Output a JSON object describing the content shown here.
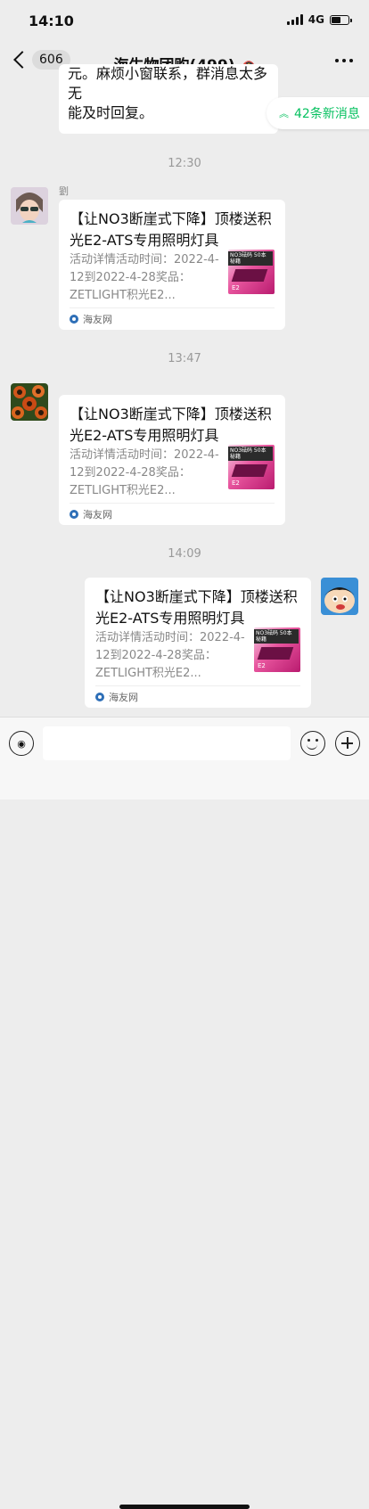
{
  "status": {
    "time": "14:10",
    "network": "4G",
    "battery_level": 0.6
  },
  "header": {
    "back_count": "606",
    "title": "海生物团购(499)",
    "mute_icon": "bell-slash-icon",
    "more_icon": "more-dots-icon"
  },
  "partial_message": {
    "text_line1": "元。麻烦小窗联系，群消息太多无",
    "text_line2": "能及时回复。"
  },
  "new_messages": {
    "label": "42条新消息"
  },
  "messages": [
    {
      "time": "12:30",
      "sender_name": "劉",
      "card": {
        "title": "【让NO3断崖式下降】顶楼送积光E2-ATS专用照明灯具",
        "desc": "活动详情活动时间：2022-4-12到2022-4-28奖品：ZETLIGHT积光E2...",
        "source": "海友网",
        "thumb_badge": "NO3砝码 50本秘籍",
        "thumb_model": "E2"
      }
    },
    {
      "time": "13:47",
      "card": {
        "title": "【让NO3断崖式下降】顶楼送积光E2-ATS专用照明灯具",
        "desc": "活动详情活动时间：2022-4-12到2022-4-28奖品：ZETLIGHT积光E2...",
        "source": "海友网",
        "thumb_badge": "NO3砝码 50本秘籍",
        "thumb_model": "E2"
      }
    },
    {
      "time": "14:09",
      "card": {
        "title": "【让NO3断崖式下降】顶楼送积光E2-ATS专用照明灯具",
        "desc": "活动详情活动时间：2022-4-12到2022-4-28奖品：ZETLIGHT积光E2...",
        "source": "海友网",
        "thumb_badge": "NO3砝码 50本秘籍",
        "thumb_model": "E2"
      }
    }
  ],
  "input": {
    "placeholder": ""
  }
}
